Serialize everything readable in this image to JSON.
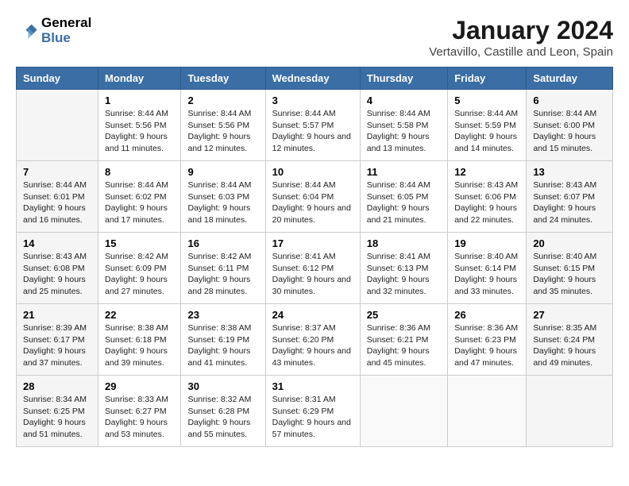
{
  "header": {
    "logo_line1": "General",
    "logo_line2": "Blue",
    "title": "January 2024",
    "subtitle": "Vertavillo, Castille and Leon, Spain"
  },
  "weekdays": [
    "Sunday",
    "Monday",
    "Tuesday",
    "Wednesday",
    "Thursday",
    "Friday",
    "Saturday"
  ],
  "weeks": [
    [
      {
        "day": "",
        "sunrise": "",
        "sunset": "",
        "daylight": ""
      },
      {
        "day": "1",
        "sunrise": "8:44 AM",
        "sunset": "5:56 PM",
        "daylight": "9 hours and 11 minutes."
      },
      {
        "day": "2",
        "sunrise": "8:44 AM",
        "sunset": "5:56 PM",
        "daylight": "9 hours and 12 minutes."
      },
      {
        "day": "3",
        "sunrise": "8:44 AM",
        "sunset": "5:57 PM",
        "daylight": "9 hours and 12 minutes."
      },
      {
        "day": "4",
        "sunrise": "8:44 AM",
        "sunset": "5:58 PM",
        "daylight": "9 hours and 13 minutes."
      },
      {
        "day": "5",
        "sunrise": "8:44 AM",
        "sunset": "5:59 PM",
        "daylight": "9 hours and 14 minutes."
      },
      {
        "day": "6",
        "sunrise": "8:44 AM",
        "sunset": "6:00 PM",
        "daylight": "9 hours and 15 minutes."
      }
    ],
    [
      {
        "day": "7",
        "sunrise": "8:44 AM",
        "sunset": "6:01 PM",
        "daylight": "9 hours and 16 minutes."
      },
      {
        "day": "8",
        "sunrise": "8:44 AM",
        "sunset": "6:02 PM",
        "daylight": "9 hours and 17 minutes."
      },
      {
        "day": "9",
        "sunrise": "8:44 AM",
        "sunset": "6:03 PM",
        "daylight": "9 hours and 18 minutes."
      },
      {
        "day": "10",
        "sunrise": "8:44 AM",
        "sunset": "6:04 PM",
        "daylight": "9 hours and 20 minutes."
      },
      {
        "day": "11",
        "sunrise": "8:44 AM",
        "sunset": "6:05 PM",
        "daylight": "9 hours and 21 minutes."
      },
      {
        "day": "12",
        "sunrise": "8:43 AM",
        "sunset": "6:06 PM",
        "daylight": "9 hours and 22 minutes."
      },
      {
        "day": "13",
        "sunrise": "8:43 AM",
        "sunset": "6:07 PM",
        "daylight": "9 hours and 24 minutes."
      }
    ],
    [
      {
        "day": "14",
        "sunrise": "8:43 AM",
        "sunset": "6:08 PM",
        "daylight": "9 hours and 25 minutes."
      },
      {
        "day": "15",
        "sunrise": "8:42 AM",
        "sunset": "6:09 PM",
        "daylight": "9 hours and 27 minutes."
      },
      {
        "day": "16",
        "sunrise": "8:42 AM",
        "sunset": "6:11 PM",
        "daylight": "9 hours and 28 minutes."
      },
      {
        "day": "17",
        "sunrise": "8:41 AM",
        "sunset": "6:12 PM",
        "daylight": "9 hours and 30 minutes."
      },
      {
        "day": "18",
        "sunrise": "8:41 AM",
        "sunset": "6:13 PM",
        "daylight": "9 hours and 32 minutes."
      },
      {
        "day": "19",
        "sunrise": "8:40 AM",
        "sunset": "6:14 PM",
        "daylight": "9 hours and 33 minutes."
      },
      {
        "day": "20",
        "sunrise": "8:40 AM",
        "sunset": "6:15 PM",
        "daylight": "9 hours and 35 minutes."
      }
    ],
    [
      {
        "day": "21",
        "sunrise": "8:39 AM",
        "sunset": "6:17 PM",
        "daylight": "9 hours and 37 minutes."
      },
      {
        "day": "22",
        "sunrise": "8:38 AM",
        "sunset": "6:18 PM",
        "daylight": "9 hours and 39 minutes."
      },
      {
        "day": "23",
        "sunrise": "8:38 AM",
        "sunset": "6:19 PM",
        "daylight": "9 hours and 41 minutes."
      },
      {
        "day": "24",
        "sunrise": "8:37 AM",
        "sunset": "6:20 PM",
        "daylight": "9 hours and 43 minutes."
      },
      {
        "day": "25",
        "sunrise": "8:36 AM",
        "sunset": "6:21 PM",
        "daylight": "9 hours and 45 minutes."
      },
      {
        "day": "26",
        "sunrise": "8:36 AM",
        "sunset": "6:23 PM",
        "daylight": "9 hours and 47 minutes."
      },
      {
        "day": "27",
        "sunrise": "8:35 AM",
        "sunset": "6:24 PM",
        "daylight": "9 hours and 49 minutes."
      }
    ],
    [
      {
        "day": "28",
        "sunrise": "8:34 AM",
        "sunset": "6:25 PM",
        "daylight": "9 hours and 51 minutes."
      },
      {
        "day": "29",
        "sunrise": "8:33 AM",
        "sunset": "6:27 PM",
        "daylight": "9 hours and 53 minutes."
      },
      {
        "day": "30",
        "sunrise": "8:32 AM",
        "sunset": "6:28 PM",
        "daylight": "9 hours and 55 minutes."
      },
      {
        "day": "31",
        "sunrise": "8:31 AM",
        "sunset": "6:29 PM",
        "daylight": "9 hours and 57 minutes."
      },
      {
        "day": "",
        "sunrise": "",
        "sunset": "",
        "daylight": ""
      },
      {
        "day": "",
        "sunrise": "",
        "sunset": "",
        "daylight": ""
      },
      {
        "day": "",
        "sunrise": "",
        "sunset": "",
        "daylight": ""
      }
    ]
  ],
  "labels": {
    "sunrise_prefix": "Sunrise: ",
    "sunset_prefix": "Sunset: ",
    "daylight_prefix": "Daylight: "
  }
}
